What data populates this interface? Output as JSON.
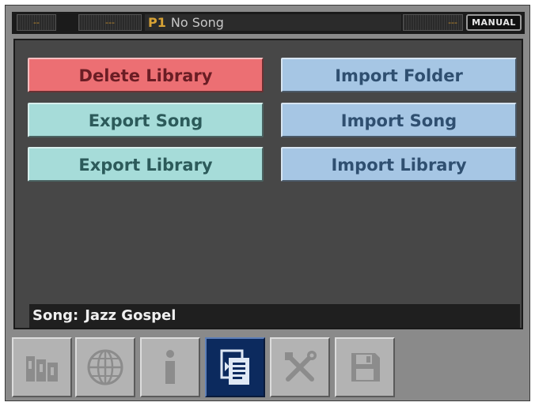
{
  "topbar": {
    "seg1": "--",
    "seg2": "---",
    "program": "P1",
    "song_name": "No Song",
    "seg3": "---",
    "mode": "MANUAL"
  },
  "buttons": {
    "delete_library": "Delete Library",
    "import_folder": "Import Folder",
    "export_song": "Export Song",
    "import_song": "Import Song",
    "export_library": "Export Library",
    "import_library": "Import Library"
  },
  "status": {
    "label": "Song:",
    "value": "Jazz Gospel"
  },
  "tabs": [
    {
      "icon": "library-icon",
      "active": false
    },
    {
      "icon": "globe-icon",
      "active": false
    },
    {
      "icon": "info-icon",
      "active": false
    },
    {
      "icon": "file-transfer-icon",
      "active": true
    },
    {
      "icon": "tools-icon",
      "active": false
    },
    {
      "icon": "save-icon",
      "active": false
    }
  ],
  "colors": {
    "delete": "#ec6f73",
    "export": "#a6dcd9",
    "import": "#a6c6e4",
    "active_tab": "#0c2a5e"
  }
}
